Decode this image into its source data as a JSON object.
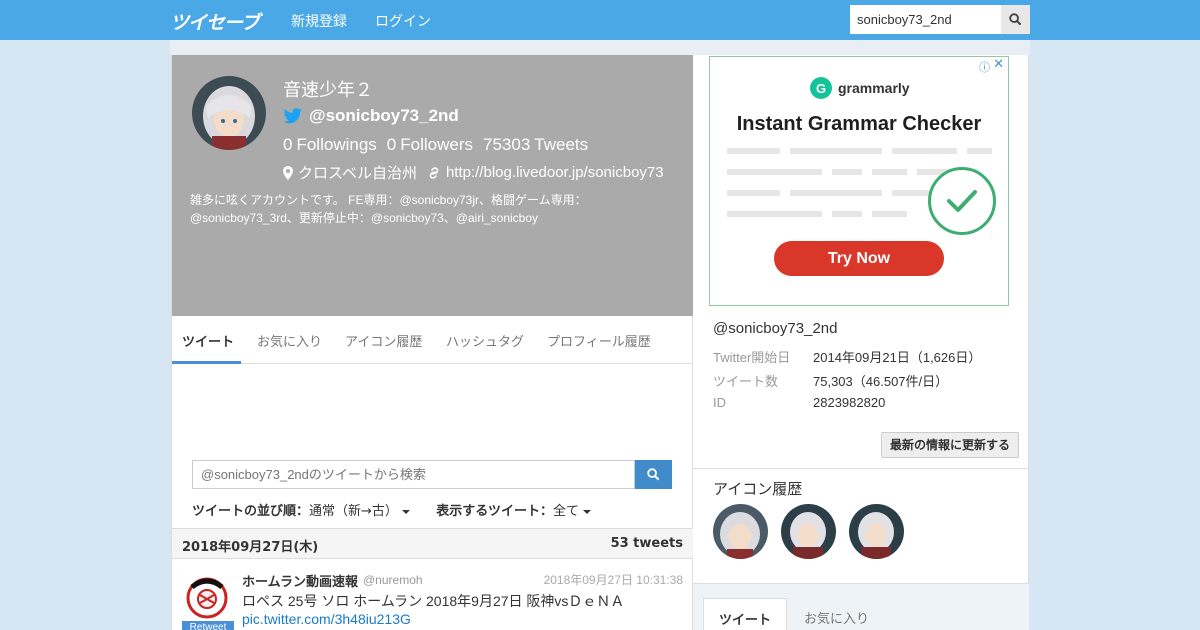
{
  "nav": {
    "logo": "ツイセーブ",
    "links": [
      "新規登録",
      "ログイン"
    ],
    "search_value": "sonicboy73_2nd"
  },
  "profile": {
    "name": "音速少年２",
    "handle": "@sonicboy73_2nd",
    "followings_count": "0",
    "followings_label": "Followings",
    "followers_count": "0",
    "followers_label": "Followers",
    "tweets_count": "75303",
    "tweets_label": "Tweets",
    "location": "クロスベル自治州",
    "url": "http://blog.livedoor.jp/sonicboy73",
    "bio": "雑多に呟くアカウントです。 FE専用：@sonicboy73jr、格闘ゲーム専用：@sonicboy73_3rd、更新停止中：@sonicboy73、@airi_sonicboy"
  },
  "tabs": [
    "ツイート",
    "お気に入り",
    "アイコン履歴",
    "ハッシュタグ",
    "プロフィール履歴"
  ],
  "tweet_search": {
    "placeholder": "@sonicboy73_2ndのツイートから検索"
  },
  "sort": {
    "order_label": "ツイートの並び順：",
    "order_value": "通常（新→古）",
    "display_label": "表示するツイート：",
    "display_value": "全て"
  },
  "day": {
    "date": "2018年09月27日(木)",
    "count": "53 tweets"
  },
  "tweet": {
    "name": "ホームラン動画速報",
    "handle": "@nuremoh",
    "time": "2018年09月27日 10:31:38",
    "text": "ロペス 25号 ソロ ホームラン 2018年9月27日 阪神vsＤｅＮＡ ",
    "link": "pic.twitter.com/3h48iu213G",
    "badge": "Retweet"
  },
  "ad": {
    "brand": "grammarly",
    "headline": "Instant Grammar Checker",
    "cta": "Try Now"
  },
  "sidebar": {
    "handle": "@sonicboy73_2nd",
    "rows": [
      {
        "label": "Twitter開始日",
        "value": "2014年09月21日（1,626日）"
      },
      {
        "label": "ツイート数",
        "value": "75,303（46.507件/日）"
      },
      {
        "label": "ID",
        "value": "2823982820"
      }
    ],
    "refresh_label": "最新の情報に更新する",
    "icon_history_title": "アイコン履歴",
    "tabs": [
      "ツイート",
      "お気に入り"
    ]
  },
  "colors": {
    "nav_bg": "#4aa8e6",
    "hero_bg": "#aaaaaa",
    "accent": "#4a90d9"
  }
}
